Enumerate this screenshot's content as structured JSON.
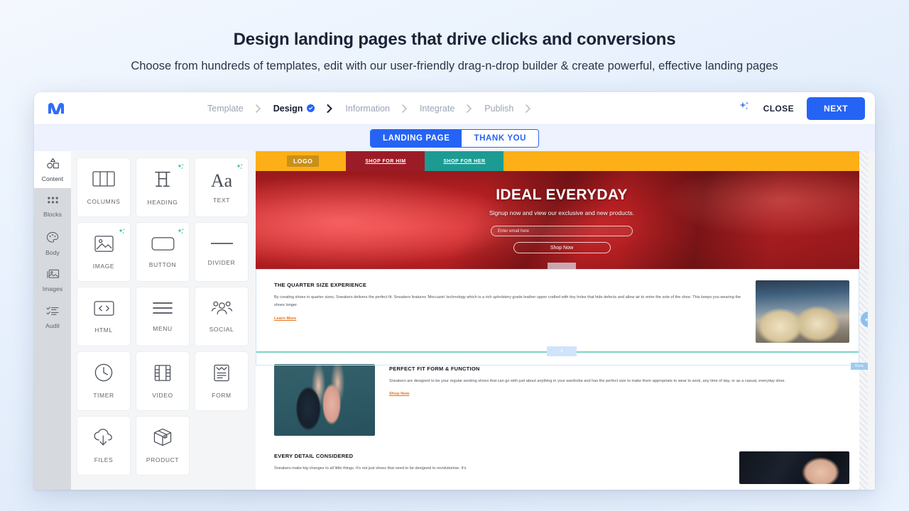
{
  "promo": {
    "headline": "Design landing pages that drive clicks and conversions",
    "subhead": "Choose from hundreds of templates, edit with our user-friendly drag-n-drop builder & create powerful, effective landing pages"
  },
  "topbar": {
    "logo_name": "moosend-logo",
    "steps": [
      {
        "label": "Template",
        "state": "done"
      },
      {
        "label": "Design",
        "state": "active"
      },
      {
        "label": "Information",
        "state": "todo"
      },
      {
        "label": "Integrate",
        "state": "todo"
      },
      {
        "label": "Publish",
        "state": "todo"
      }
    ],
    "ai_icon": "ai-sparkles-icon",
    "close_label": "CLOSE",
    "next_label": "NEXT",
    "accent_color": "#2563f5"
  },
  "page_tabs": {
    "landing_page": "LANDING PAGE",
    "thank_you": "THANK YOU",
    "selected": "LANDING PAGE"
  },
  "rail": {
    "items": [
      {
        "label": "Content",
        "icon": "shapes-icon",
        "active": true
      },
      {
        "label": "Blocks",
        "icon": "grid-dots-icon",
        "active": false
      },
      {
        "label": "Body",
        "icon": "palette-icon",
        "active": false
      },
      {
        "label": "Images",
        "icon": "image-stack-icon",
        "active": false
      },
      {
        "label": "Audit",
        "icon": "checklist-icon",
        "active": false
      }
    ]
  },
  "palette": {
    "tiles": [
      {
        "label": "COLUMNS",
        "icon": "columns-icon",
        "ai": false
      },
      {
        "label": "HEADING",
        "icon": "heading-icon",
        "ai": true
      },
      {
        "label": "TEXT",
        "icon": "text-icon",
        "ai": true
      },
      {
        "label": "IMAGE",
        "icon": "image-icon",
        "ai": true
      },
      {
        "label": "BUTTON",
        "icon": "button-icon",
        "ai": true
      },
      {
        "label": "DIVIDER",
        "icon": "divider-icon",
        "ai": false
      },
      {
        "label": "HTML",
        "icon": "code-icon",
        "ai": false
      },
      {
        "label": "MENU",
        "icon": "menu-icon",
        "ai": false
      },
      {
        "label": "SOCIAL",
        "icon": "social-icon",
        "ai": false
      },
      {
        "label": "TIMER",
        "icon": "clock-icon",
        "ai": false
      },
      {
        "label": "VIDEO",
        "icon": "film-icon",
        "ai": false
      },
      {
        "label": "FORM",
        "icon": "form-icon",
        "ai": false
      },
      {
        "label": "FILES",
        "icon": "cloud-download-icon",
        "ai": false
      },
      {
        "label": "PRODUCT",
        "icon": "box-icon",
        "ai": false
      }
    ]
  },
  "canvas": {
    "site_nav": {
      "logo": "LOGO",
      "link_him": "SHOP FOR HIM",
      "link_her": "SHOP FOR HER",
      "bar_color": "#fcaf17",
      "him_color": "#9b1c26",
      "her_color": "#1c9b92"
    },
    "hero": {
      "title": "IDEAL EVERYDAY",
      "subtitle": "Signup now and view our exclusive and new products.",
      "email_placeholder": "Enter email here",
      "cta": "Shop Now"
    },
    "blocks": [
      {
        "title": "THE QUARTER SIZE EXPERIENCE",
        "body": "By creating shoes in quarter sizes, Sneakers delivers the perfect fit. Sneakers features 'Moccasin' technology which is a rich upholstery grade leather upper crafted with tiny holes that hide defects and allow air to enter the sole of the shoe. This keeps you wearing the shoes longer.",
        "link": "Learn More",
        "image": "bowling-shoes-photo"
      },
      {
        "title": "PERFECT FIT FORM & FUNCTION",
        "body": "Sneakers are designed to be your regular working shoes that can go with just about anything in your wardrobe and has the perfect size to make them appropriate to wear to work, any time of day, or as a casual, everyday shoe.",
        "link": "Shop Now",
        "image": "sneaker-ballet-photo"
      },
      {
        "title": "EVERY DETAIL CONSIDERED",
        "body": "Sneakers make big changes to all little things. It's not just shoes that need to be designed to revolutionise. It's",
        "link": "",
        "image": "suit-detail-photo"
      }
    ],
    "overlays": {
      "row_tag": "Row",
      "move_handle_icon": "move-arrows-icon",
      "drop_plus": "+"
    },
    "link_color": "#e8741a",
    "divider_color": "#7fcfc4"
  }
}
